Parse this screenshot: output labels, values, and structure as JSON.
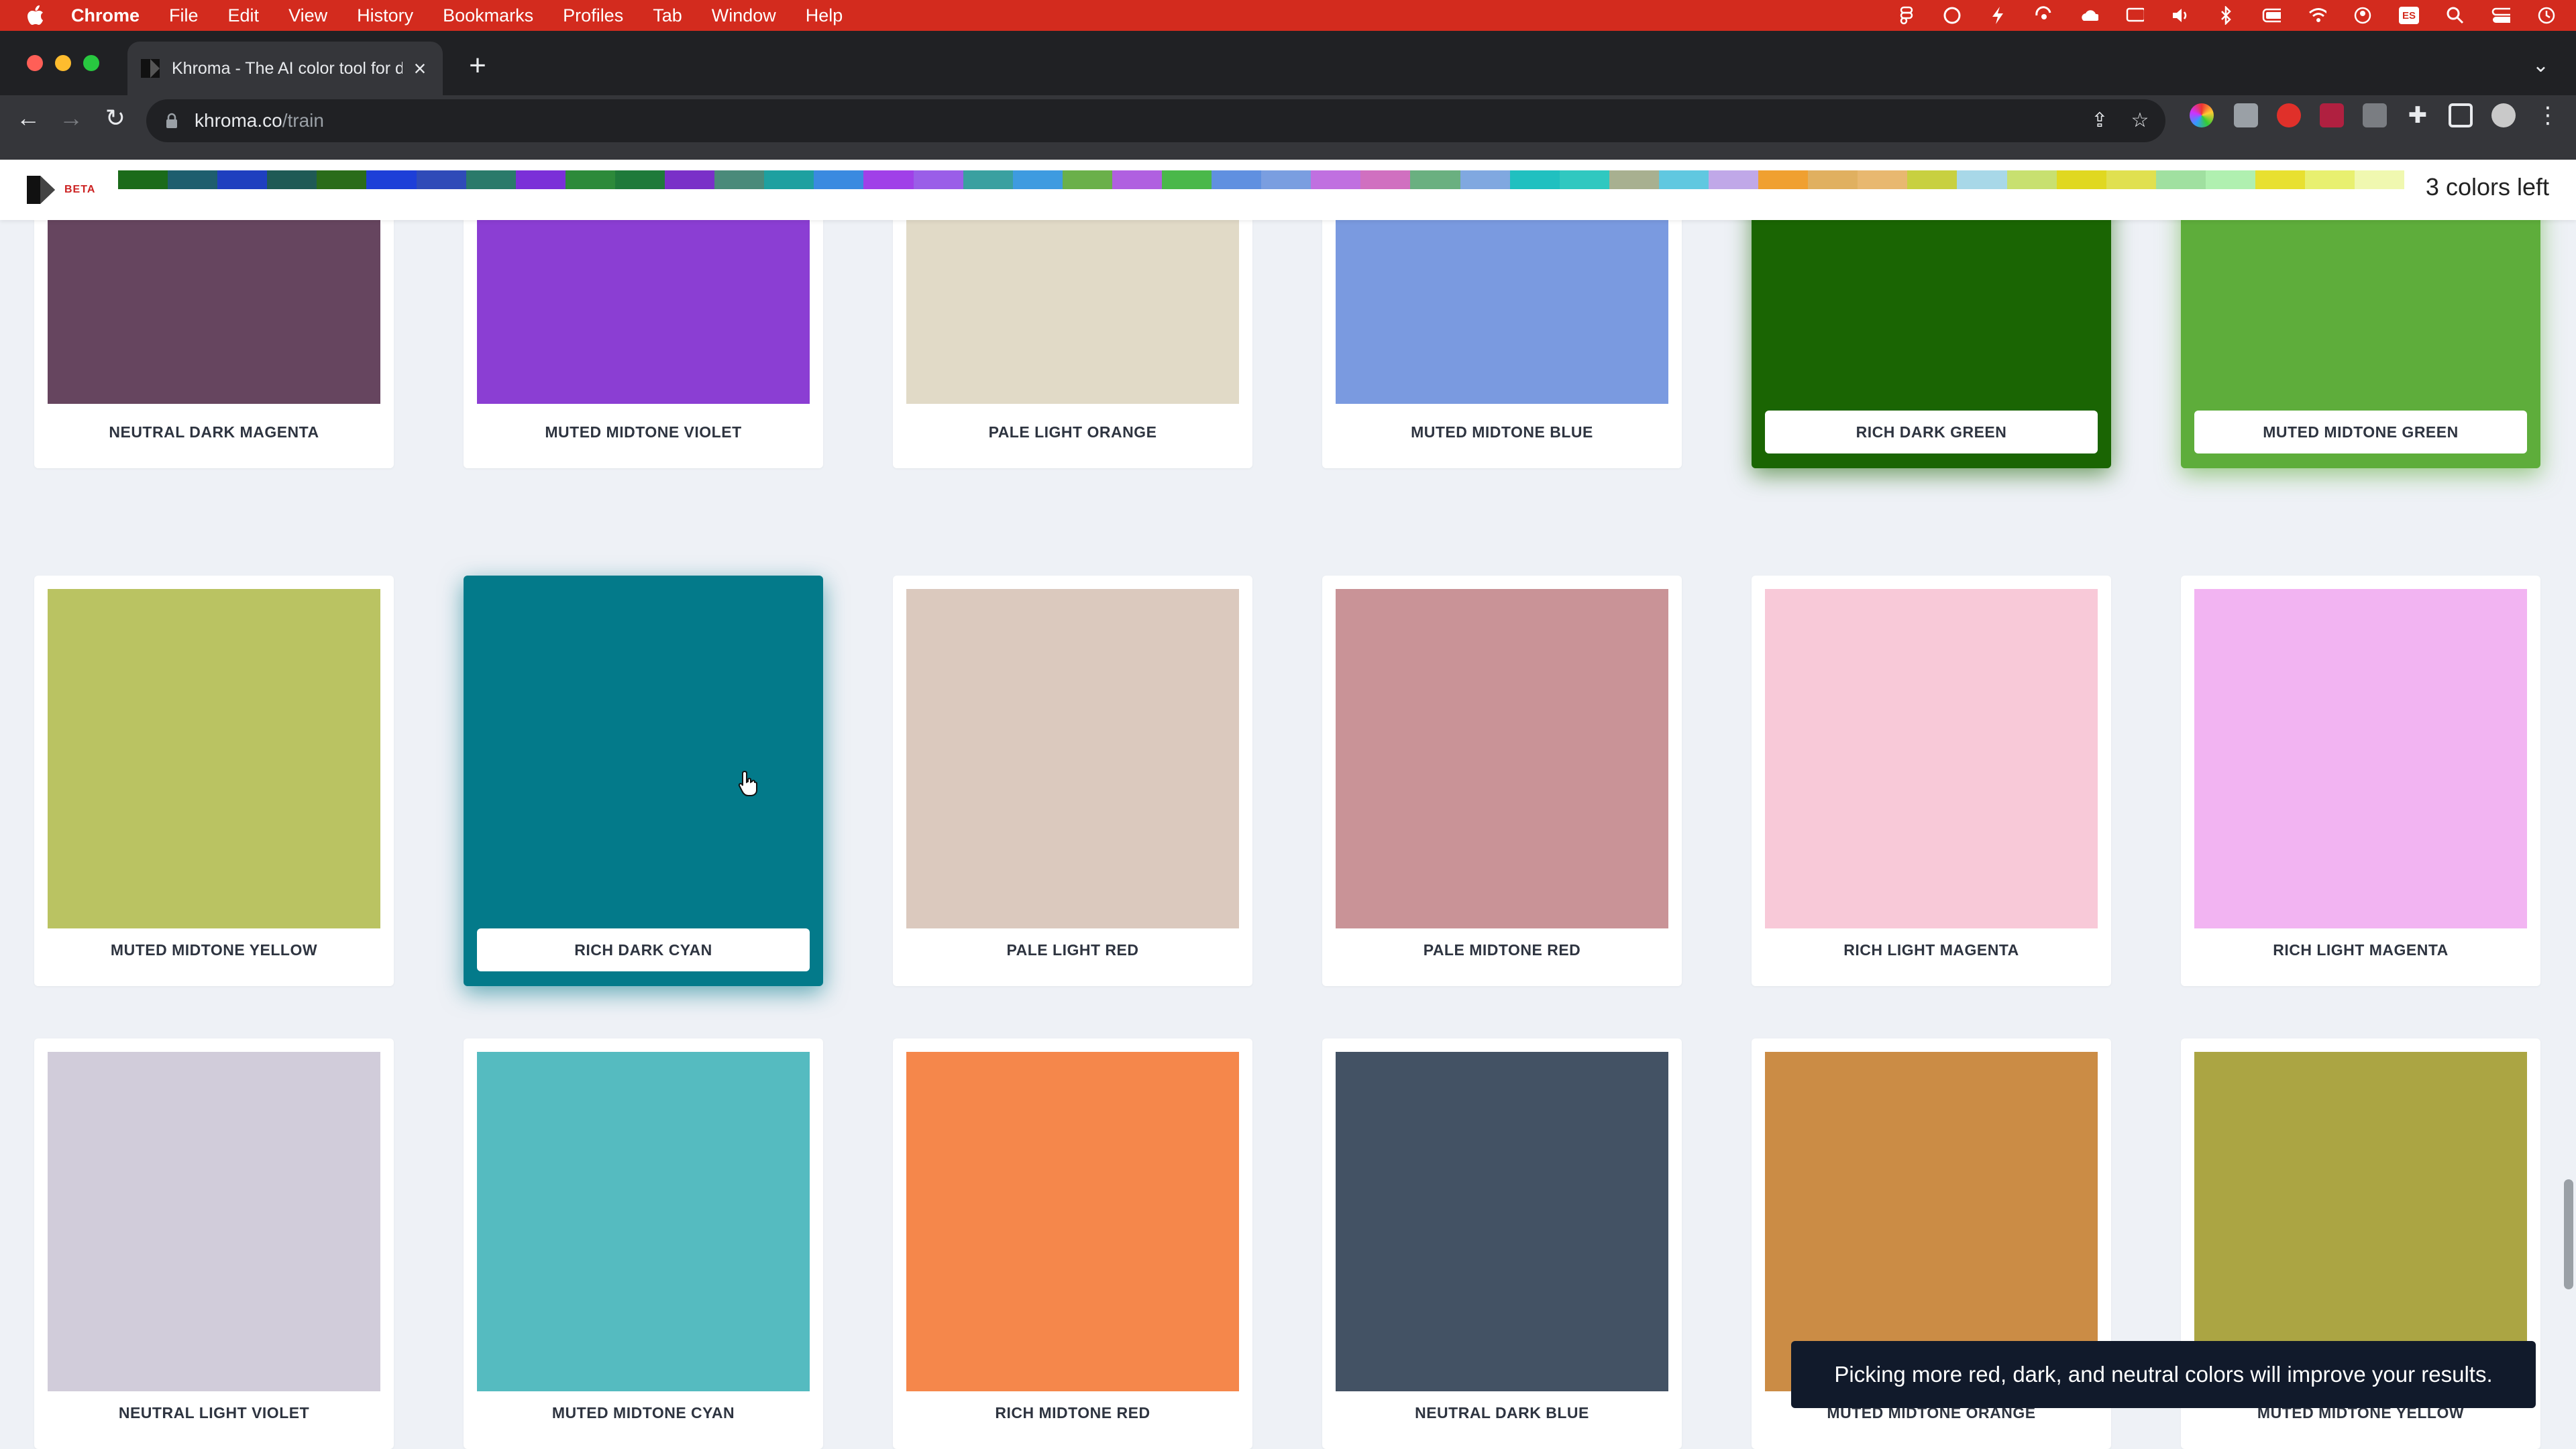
{
  "menubar": {
    "app": "Chrome",
    "items": [
      "File",
      "Edit",
      "View",
      "History",
      "Bookmarks",
      "Profiles",
      "Tab",
      "Window",
      "Help"
    ],
    "tray_icons": [
      "figma-icon",
      "creative-cloud-icon",
      "bolt-icon",
      "sync-icon",
      "cloud-icon",
      "screen-mirror-icon",
      "volume-icon",
      "bluetooth-icon",
      "battery-icon",
      "wifi-icon",
      "user-icon",
      "keyboard-es-icon",
      "search-icon",
      "control-center-icon",
      "clock-icon"
    ],
    "keyboard_layout": "ES"
  },
  "browser": {
    "tab_title": "Khroma - The AI color tool for d",
    "tab_close": "×",
    "new_tab": "+",
    "url_host": "khroma.co",
    "url_path": "/train"
  },
  "app": {
    "beta": "BETA",
    "colors_left": "3 colors left",
    "palette_strip": [
      "#1b6b1a",
      "#1e5e6e",
      "#1f3fbf",
      "#1f5a55",
      "#2a6c1a",
      "#1d3fd8",
      "#2f4bb8",
      "#2a7a6a",
      "#7b2fd8",
      "#2d8a3a",
      "#1f7a3a",
      "#7a30c8",
      "#4a8a7a",
      "#1ea0a0",
      "#3a8ae0",
      "#a040e8",
      "#9a5ee8",
      "#3aa0a0",
      "#3e9be0",
      "#6ab04a",
      "#b060e0",
      "#4ab84a",
      "#6090e0",
      "#7a9ee0",
      "#c070e0",
      "#d070c0",
      "#6ab080",
      "#80a8e0",
      "#20c0c0",
      "#30c8c0",
      "#a8b090",
      "#60c8e0",
      "#c0a8e8",
      "#f0a030",
      "#e0b060",
      "#e8b870",
      "#c8d040",
      "#a8d8e8",
      "#c8e070",
      "#e0d820",
      "#e0e050",
      "#a0e0a0",
      "#b0f0b0",
      "#e8e030",
      "#e8f070",
      "#f0f8b0"
    ],
    "cards": [
      {
        "name": "NEUTRAL DARK MAGENTA",
        "color": "#66455f",
        "selected": false
      },
      {
        "name": "MUTED MIDTONE VIOLET",
        "color": "#8b3ed3",
        "selected": false
      },
      {
        "name": "PALE LIGHT ORANGE",
        "color": "#e1dac7",
        "selected": false
      },
      {
        "name": "MUTED MIDTONE BLUE",
        "color": "#7a9ae0",
        "selected": false
      },
      {
        "name": "RICH DARK GREEN",
        "color": "#1a6503",
        "selected": true
      },
      {
        "name": "MUTED MIDTONE GREEN",
        "color": "#5ead3b",
        "selected": true
      },
      {
        "name": "MUTED MIDTONE YELLOW",
        "color": "#bac362",
        "selected": false
      },
      {
        "name": "RICH DARK CYAN",
        "color": "#037a8a",
        "selected": true
      },
      {
        "name": "PALE LIGHT RED",
        "color": "#dbc9be",
        "selected": false
      },
      {
        "name": "PALE MIDTONE RED",
        "color": "#c99397",
        "selected": false
      },
      {
        "name": "RICH LIGHT MAGENTA",
        "color": "#f8c9d8",
        "selected": false
      },
      {
        "name": "RICH LIGHT MAGENTA",
        "color": "#f2b4f2",
        "selected": false
      },
      {
        "name": "NEUTRAL LIGHT VIOLET",
        "color": "#d1ccda",
        "selected": false
      },
      {
        "name": "MUTED MIDTONE CYAN",
        "color": "#55bbc0",
        "selected": false
      },
      {
        "name": "RICH MIDTONE RED",
        "color": "#f5874b",
        "selected": false
      },
      {
        "name": "NEUTRAL DARK BLUE",
        "color": "#435264",
        "selected": false
      },
      {
        "name": "MUTED MIDTONE ORANGE",
        "color": "#cb8c45",
        "selected": false
      },
      {
        "name": "MUTED MIDTONE YELLOW",
        "color": "#aba543",
        "selected": false
      }
    ],
    "toast": "Picking more red, dark, and neutral colors will improve your results."
  }
}
